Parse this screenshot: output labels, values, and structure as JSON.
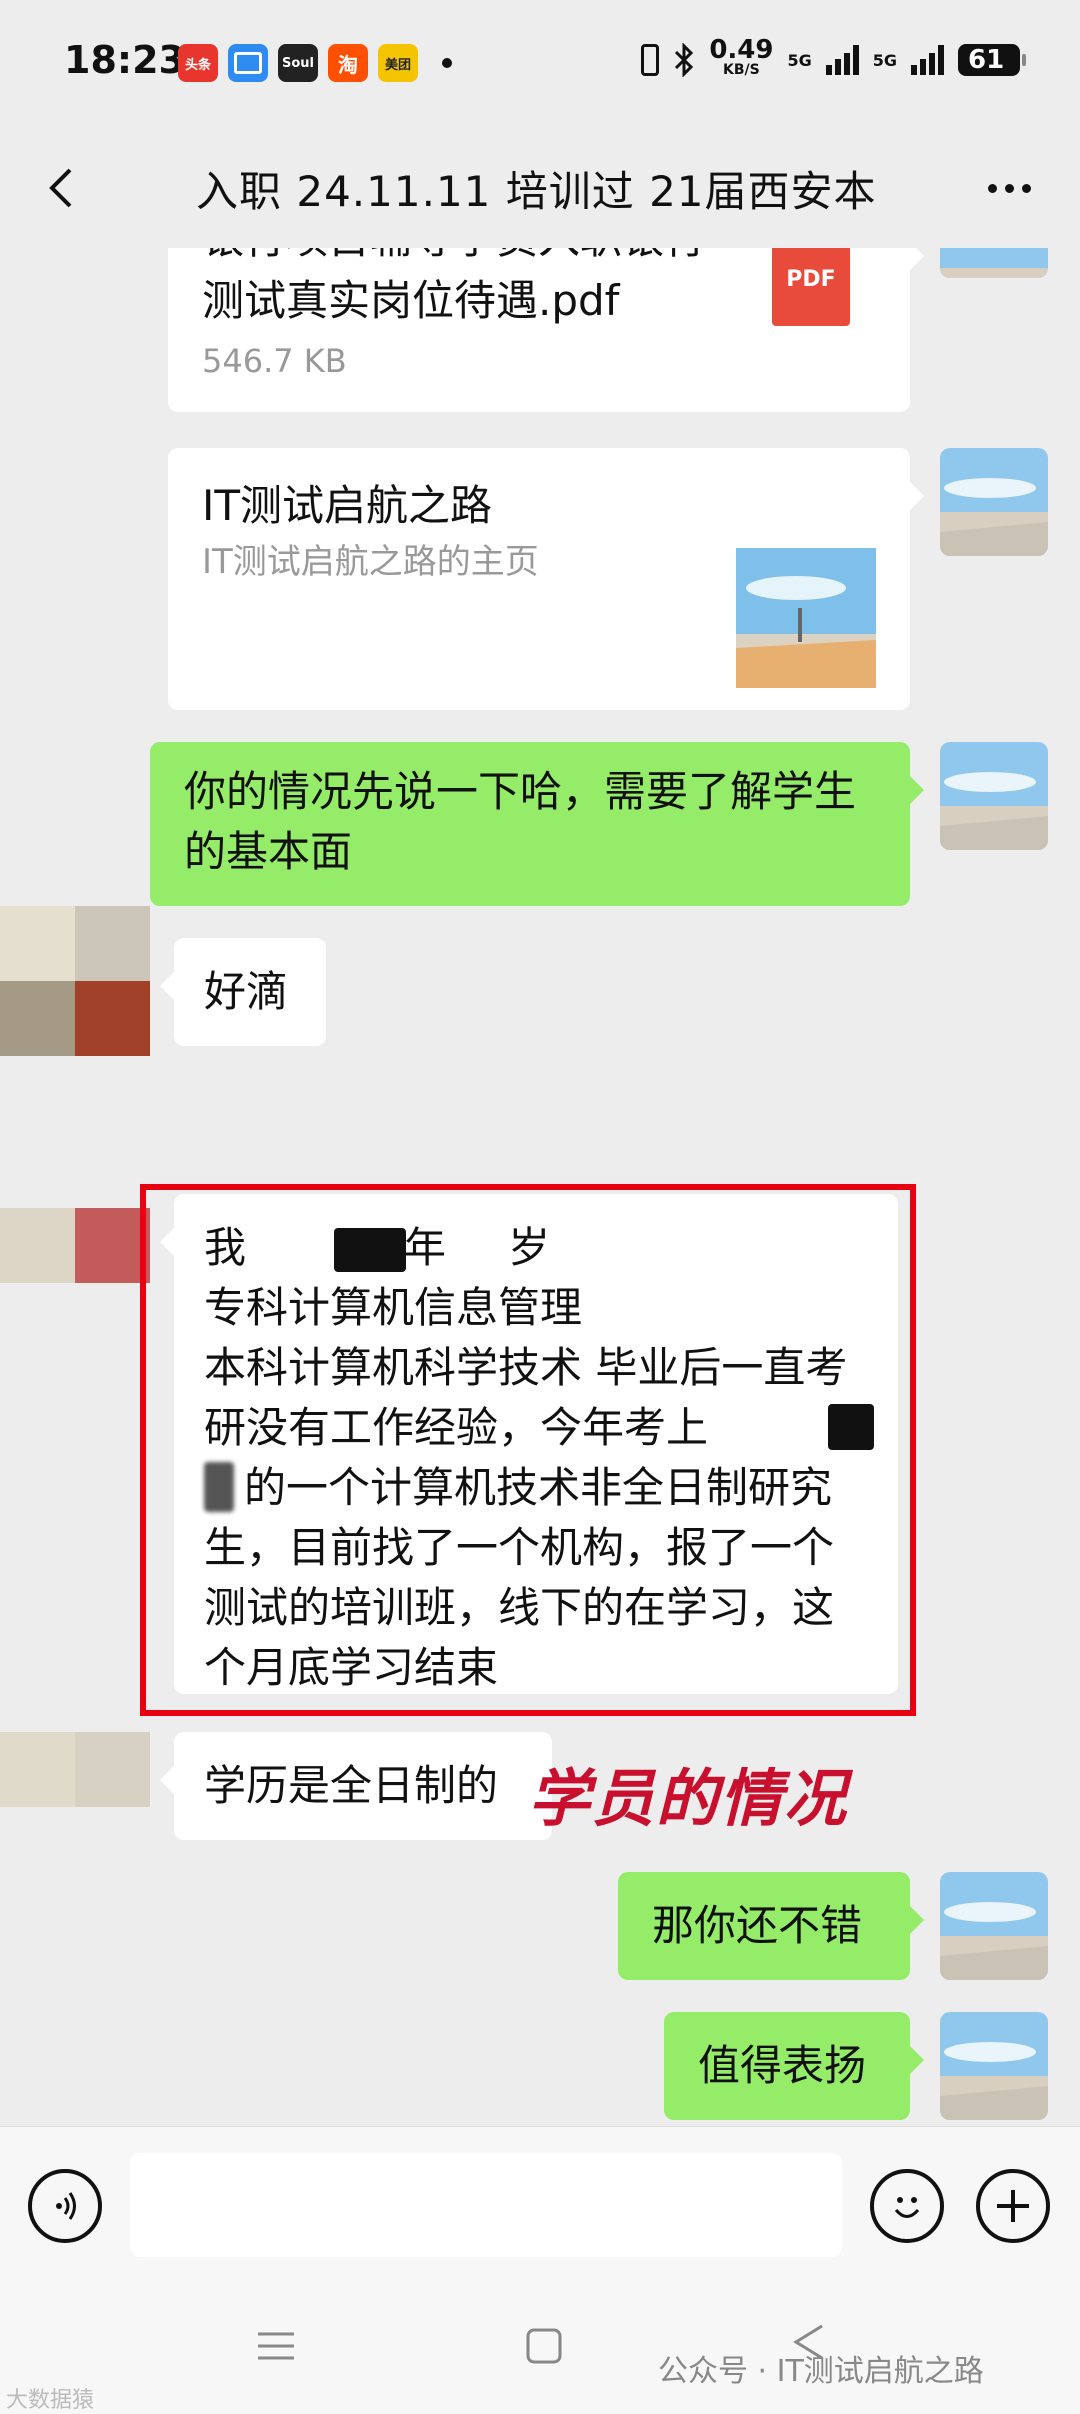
{
  "status_bar": {
    "time": "18:23",
    "apps": [
      {
        "name": "toutiao",
        "label": "头条",
        "color": "#e8362f"
      },
      {
        "name": "files",
        "label": "",
        "color": "#2e8bf0"
      },
      {
        "name": "soul",
        "label": "Soul",
        "color": "#222222"
      },
      {
        "name": "taobao",
        "label": "淘",
        "color": "#ff5000"
      },
      {
        "name": "meituan",
        "label": "美团",
        "color": "#f5c400"
      }
    ],
    "speed_value": "0.49",
    "speed_unit": "KB/S",
    "net1": "5G",
    "net2": "5G",
    "battery": "61"
  },
  "header": {
    "title": "入职 24.11.11 培训过 21届西安本"
  },
  "messages": {
    "file": {
      "name": "银行项目辅导学员入职银行测试真实岗位待遇.pdf",
      "size": "546.7 KB",
      "icon_label": "PDF"
    },
    "link_card": {
      "title": "IT测试启航之路",
      "subtitle": "IT测试启航之路的主页"
    },
    "msg1": "你的情况先说一下哈，需要了解学生的基本面",
    "msg2": "好滴",
    "msg3_lines": [
      "我",
      "专科计算机信息管理",
      "本科计算机科学技术 毕业后一直考",
      "研没有工作经验，今年考上",
      "的一个计算机技术非全日制研究",
      "生，目前找了一个机构，报了一个",
      "测试的培训班，线下的在学习，这",
      "个月底学习结束"
    ],
    "msg3_fragment_a": "年",
    "msg3_fragment_b": "岁",
    "msg4": "学历是全日制的",
    "annotation": "学员的情况",
    "msg5": "那你还不错",
    "msg6": "值得表扬"
  },
  "input": {
    "placeholder": ""
  },
  "footer": {
    "watermark": "公众号 · IT测试启航之路",
    "watermark_small": "大数据猿"
  }
}
